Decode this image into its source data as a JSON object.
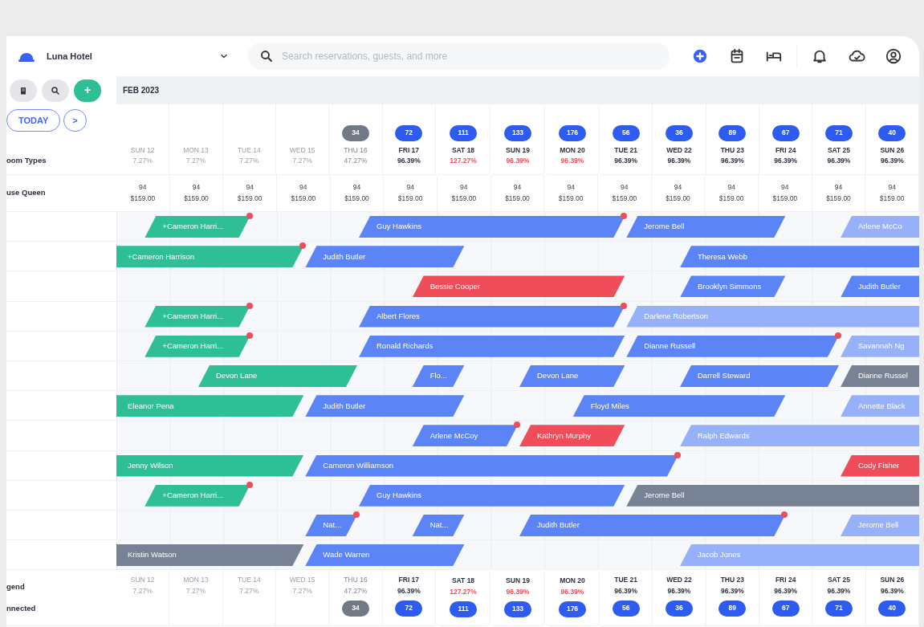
{
  "topbar": {
    "hotel": "Luna Hotel",
    "search": {
      "placeholder": "Search reservations, guests, and more"
    }
  },
  "sidebar": {
    "today": "TODAY",
    "next": ">",
    "add": "+",
    "header_label": "oom Types",
    "room_type": "use Queen",
    "footer_labels": [
      "gend",
      "nnected"
    ]
  },
  "month": "FEB 2023",
  "days": [
    {
      "name": "SUN 12",
      "occupancy": "7.27%",
      "kind": "past",
      "alert": false
    },
    {
      "name": "MON 13",
      "occupancy": "7.27%",
      "kind": "past",
      "alert": false
    },
    {
      "name": "TUE 14",
      "occupancy": "7.27%",
      "kind": "past",
      "alert": false
    },
    {
      "name": "WED 15",
      "occupancy": "7.27%",
      "kind": "past",
      "alert": false
    },
    {
      "name": "THU 16",
      "occupancy": "47.27%",
      "kind": "today",
      "alert": false,
      "badge": "34"
    },
    {
      "name": "FRI 17",
      "occupancy": "96.39%",
      "kind": "future",
      "alert": false,
      "badge": "72"
    },
    {
      "name": "SAT 18",
      "occupancy": "127.27%",
      "kind": "future",
      "alert": true,
      "badge": "111"
    },
    {
      "name": "SUN 19",
      "occupancy": "96.39%",
      "kind": "future",
      "alert": true,
      "badge": "133"
    },
    {
      "name": "MON 20",
      "occupancy": "96.39%",
      "kind": "future",
      "alert": true,
      "badge": "176"
    },
    {
      "name": "TUE 21",
      "occupancy": "96.39%",
      "kind": "future",
      "alert": false,
      "badge": "56"
    },
    {
      "name": "WED 22",
      "occupancy": "96.39%",
      "kind": "future",
      "alert": false,
      "badge": "36"
    },
    {
      "name": "THU 23",
      "occupancy": "96.39%",
      "kind": "future",
      "alert": false,
      "badge": "89"
    },
    {
      "name": "FRI 24",
      "occupancy": "96.39%",
      "kind": "future",
      "alert": false,
      "badge": "67"
    },
    {
      "name": "SAT 25",
      "occupancy": "96.39%",
      "kind": "future",
      "alert": false,
      "badge": "71"
    },
    {
      "name": "SUN 26",
      "occupancy": "96.39%",
      "kind": "future",
      "alert": false,
      "badge": "40"
    }
  ],
  "rates": [
    {
      "available": "94",
      "rate": "$159.00"
    },
    {
      "available": "94",
      "rate": "$159.00"
    },
    {
      "available": "94",
      "rate": "$159.00"
    },
    {
      "available": "94",
      "rate": "$159.00"
    },
    {
      "available": "94",
      "rate": "$159.00"
    },
    {
      "available": "94",
      "rate": "$159.00"
    },
    {
      "available": "94",
      "rate": "$159.00"
    },
    {
      "available": "94",
      "rate": "$159.00"
    },
    {
      "available": "94",
      "rate": "$159.00"
    },
    {
      "available": "94",
      "rate": "$159.00"
    },
    {
      "available": "94",
      "rate": "$159.00"
    },
    {
      "available": "94",
      "rate": "$159.00"
    },
    {
      "available": "94",
      "rate": "$159.00"
    },
    {
      "available": "94",
      "rate": "$159.00"
    },
    {
      "available": "94",
      "rate": "$159.00"
    }
  ],
  "rooms": [
    {
      "bookings": [
        {
          "guest": "+Cameron Harri...",
          "kind": "green",
          "flag": true
        },
        {
          "guest": "Guy Hawkins",
          "kind": "blue",
          "flag": true
        },
        {
          "guest": "Jerome Bell",
          "kind": "blue",
          "flag": false
        },
        {
          "guest": "Arlene McCo",
          "kind": "pale",
          "flag": false
        }
      ]
    },
    {
      "bookings": [
        {
          "guest": "+Cameron Harrison",
          "kind": "green",
          "flag": true
        },
        {
          "guest": "Judith Butler",
          "kind": "blue",
          "flag": false
        },
        {
          "guest": "Theresa Webb",
          "kind": "blue",
          "flag": false
        }
      ]
    },
    {
      "bookings": [
        {
          "guest": "Bessie Cooper",
          "kind": "red",
          "flag": false
        },
        {
          "guest": "Brooklyn Simmons",
          "kind": "blue",
          "flag": false
        },
        {
          "guest": "Judith Butler",
          "kind": "blue",
          "flag": false
        }
      ]
    },
    {
      "bookings": [
        {
          "guest": "+Cameron Harri...",
          "kind": "green",
          "flag": true
        },
        {
          "guest": "Albert Flores",
          "kind": "blue",
          "flag": true
        },
        {
          "guest": "Darlene Robertson",
          "kind": "pale",
          "flag": false
        }
      ]
    },
    {
      "bookings": [
        {
          "guest": "+Cameron Harri...",
          "kind": "green",
          "flag": true
        },
        {
          "guest": "Ronald Richards",
          "kind": "blue",
          "flag": false
        },
        {
          "guest": "Dianne Russell",
          "kind": "blue",
          "flag": true
        },
        {
          "guest": "Savannah Ng",
          "kind": "pale",
          "flag": false
        }
      ]
    },
    {
      "bookings": [
        {
          "guest": "Devon Lane",
          "kind": "green",
          "flag": false
        },
        {
          "guest": "Flo...",
          "kind": "blue",
          "flag": false
        },
        {
          "guest": "Devon Lane",
          "kind": "blue",
          "flag": false
        },
        {
          "guest": "Darrell Steward",
          "kind": "blue",
          "flag": false
        },
        {
          "guest": "Dianne Russel",
          "kind": "grey",
          "flag": false
        }
      ]
    },
    {
      "bookings": [
        {
          "guest": "Eleanor Pena",
          "kind": "green",
          "flag": false
        },
        {
          "guest": "Judith Butler",
          "kind": "blue",
          "flag": false
        },
        {
          "guest": "Floyd Miles",
          "kind": "blue",
          "flag": false
        },
        {
          "guest": "Annette Black",
          "kind": "pale",
          "flag": false
        }
      ]
    },
    {
      "bookings": [
        {
          "guest": "Arlene McCoy",
          "kind": "blue",
          "flag": true
        },
        {
          "guest": "Kathryn Murphy",
          "kind": "red",
          "flag": false
        },
        {
          "guest": "Ralph Edwards",
          "kind": "pale",
          "flag": false
        }
      ]
    },
    {
      "bookings": [
        {
          "guest": "Jenny Wilson",
          "kind": "green",
          "flag": false
        },
        {
          "guest": "Cameron Williamson",
          "kind": "blue",
          "flag": true
        },
        {
          "guest": "Cody Fisher",
          "kind": "red",
          "flag": false
        }
      ]
    },
    {
      "bookings": [
        {
          "guest": "+Cameron Harri...",
          "kind": "green",
          "flag": true
        },
        {
          "guest": "Guy Hawkins",
          "kind": "blue",
          "flag": false
        },
        {
          "guest": "Jerome Bell",
          "kind": "grey",
          "flag": false
        }
      ]
    },
    {
      "bookings": [
        {
          "guest": "Nat...",
          "kind": "blue",
          "flag": true
        },
        {
          "guest": "Nat...",
          "kind": "blue",
          "flag": false
        },
        {
          "guest": "Judith Butler",
          "kind": "blue",
          "flag": true
        },
        {
          "guest": "Jerome Bell",
          "kind": "pale",
          "flag": false
        }
      ]
    },
    {
      "bookings": [
        {
          "guest": "Kristin Watson",
          "kind": "grey",
          "flag": false
        },
        {
          "guest": "Wade Warren",
          "kind": "blue",
          "flag": false
        },
        {
          "guest": "Jacob Jones",
          "kind": "pale",
          "flag": false
        }
      ]
    }
  ],
  "footer_days": [
    {
      "name": "SUN 12",
      "occupancy": "7.27%",
      "kind": "past",
      "alert": false
    },
    {
      "name": "MON 13",
      "occupancy": "7.27%",
      "kind": "past",
      "alert": false
    },
    {
      "name": "TUE 14",
      "occupancy": "7.27%",
      "kind": "past",
      "alert": false
    },
    {
      "name": "WED 15",
      "occupancy": "7.27%",
      "kind": "past",
      "alert": false
    },
    {
      "name": "THU 16",
      "occupancy": "47.27%",
      "kind": "today",
      "alert": false,
      "badge": "34"
    },
    {
      "name": "FRI 17",
      "occupancy": "96.39%",
      "kind": "future",
      "alert": false,
      "badge": "72"
    },
    {
      "name": "SAT 18",
      "occupancy": "127.27%",
      "kind": "future",
      "alert": true,
      "badge": "111"
    },
    {
      "name": "SUN 19",
      "occupancy": "96.39%",
      "kind": "future",
      "alert": true,
      "badge": "133"
    },
    {
      "name": "MON 20",
      "occupancy": "96.39%",
      "kind": "future",
      "alert": true,
      "badge": "176"
    },
    {
      "name": "TUE 21",
      "occupancy": "96.39%",
      "kind": "future",
      "alert": false,
      "badge": "56"
    },
    {
      "name": "WED 22",
      "occupancy": "96.39%",
      "kind": "future",
      "alert": false,
      "badge": "36"
    },
    {
      "name": "THU 23",
      "occupancy": "96.39%",
      "kind": "future",
      "alert": false,
      "badge": "89"
    },
    {
      "name": "FRI 24",
      "occupancy": "96.39%",
      "kind": "future",
      "alert": false,
      "badge": "67"
    },
    {
      "name": "SAT 25",
      "occupancy": "96.39%",
      "kind": "future",
      "alert": false,
      "badge": "71"
    },
    {
      "name": "SUN 26",
      "occupancy": "96.39%",
      "kind": "future",
      "alert": false,
      "badge": "40"
    }
  ]
}
